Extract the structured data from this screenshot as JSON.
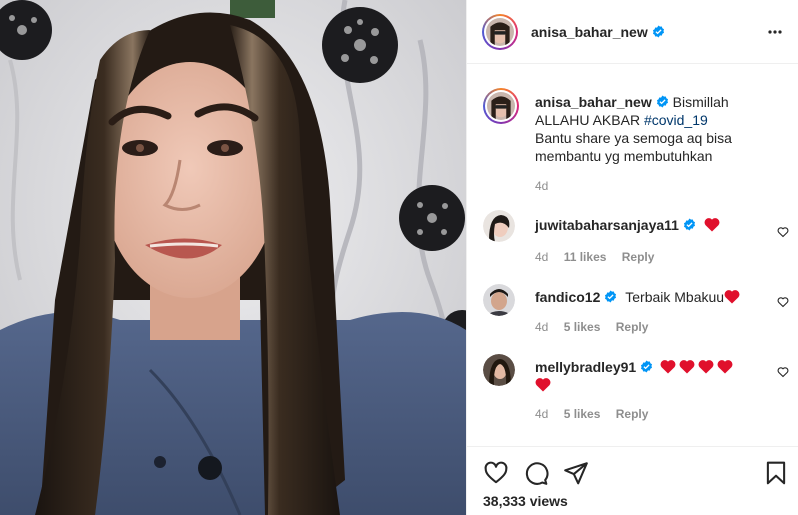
{
  "post": {
    "author": "anisa_bahar_new",
    "verified": true,
    "caption_line1": "Bismillah",
    "caption_line2": "ALLAHU AKBAR",
    "hashtag": "#covid_19",
    "caption_line3": "Bantu share ya semoga aq bisa membantu yg membutuhkan",
    "time": "4d",
    "views": "38,333 views"
  },
  "comments": [
    {
      "username": "juwitabaharsanjaya11",
      "verified": true,
      "text": "",
      "hearts": 1,
      "time": "4d",
      "likes": "11 likes",
      "reply": "Reply"
    },
    {
      "username": "fandico12",
      "verified": true,
      "text": "Terbaik Mbakuu",
      "hearts": 1,
      "time": "4d",
      "likes": "5 likes",
      "reply": "Reply"
    },
    {
      "username": "mellybradley91",
      "verified": true,
      "text": "",
      "hearts": 5,
      "time": "4d",
      "likes": "5 likes",
      "reply": "Reply"
    }
  ],
  "icons": {
    "more": "more-options-icon",
    "like": "heart-icon",
    "comment": "comment-icon",
    "share": "share-icon",
    "save": "bookmark-icon",
    "verified": "verified-badge-icon"
  },
  "colors": {
    "verified_blue": "#0095f6",
    "heart_red": "#ed4956",
    "secondary_text": "#8e8e8e",
    "link": "#00376b"
  }
}
